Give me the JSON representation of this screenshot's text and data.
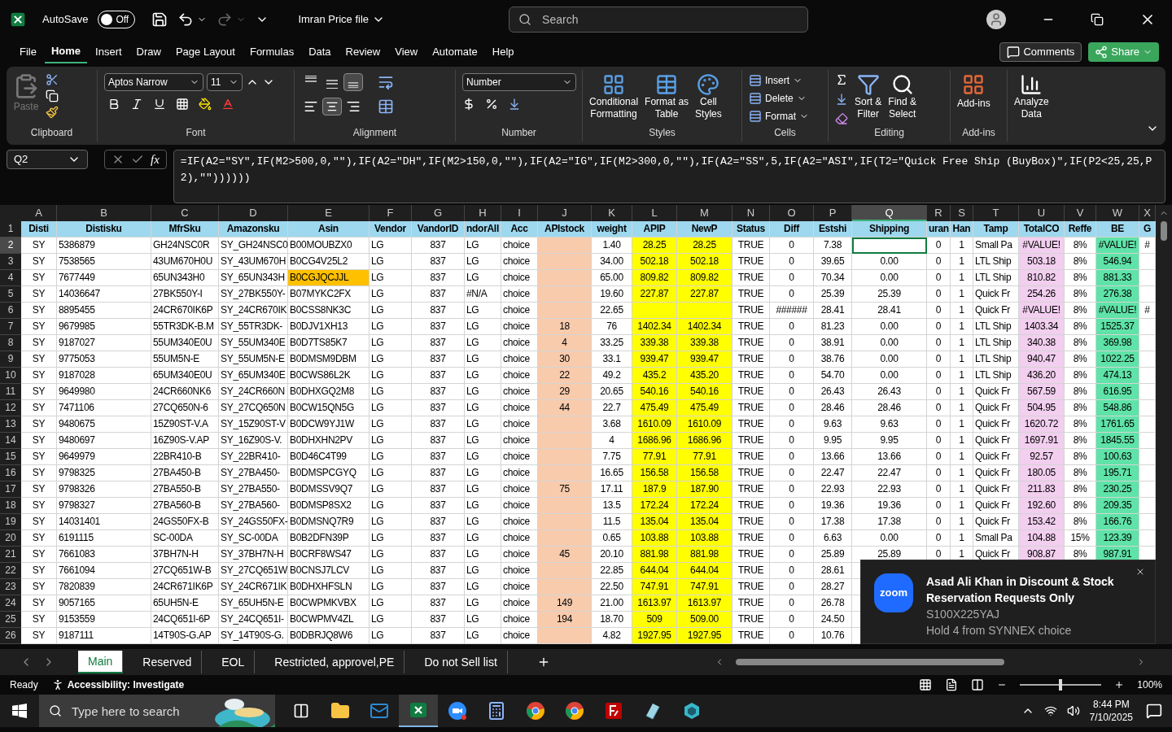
{
  "titlebar": {
    "autosave": "AutoSave",
    "autosave_toggle": {
      "label": "Off",
      "on": false
    },
    "file_name": "Imran Price file",
    "search": {
      "placeholder": "Search"
    }
  },
  "menu": {
    "tabs": [
      {
        "label": "File",
        "selected": false
      },
      {
        "label": "Home",
        "selected": true
      },
      {
        "label": "Insert",
        "selected": false
      },
      {
        "label": "Draw",
        "selected": false
      },
      {
        "label": "Page Layout",
        "selected": false
      },
      {
        "label": "Formulas",
        "selected": false
      },
      {
        "label": "Data",
        "selected": false
      },
      {
        "label": "Review",
        "selected": false
      },
      {
        "label": "View",
        "selected": false
      },
      {
        "label": "Automate",
        "selected": false
      },
      {
        "label": "Help",
        "selected": false
      }
    ],
    "comments": "Comments",
    "share": "Share"
  },
  "ribbon": {
    "clipboard": {
      "label": "Clipboard",
      "paste": "Paste",
      "paste_disabled": true
    },
    "font": {
      "label": "Font",
      "family": "Aptos Narrow",
      "size": "11"
    },
    "alignment": {
      "label": "Alignment",
      "vertical": [
        {
          "kind": "top",
          "selected": false
        },
        {
          "kind": "middle",
          "selected": false
        },
        {
          "kind": "bottom",
          "selected": true
        }
      ],
      "horizontal": [
        {
          "kind": "left",
          "selected": false
        },
        {
          "kind": "center",
          "selected": true
        },
        {
          "kind": "right",
          "selected": false
        }
      ]
    },
    "number": {
      "label": "Number",
      "format": "Number"
    },
    "styles": {
      "label": "Styles",
      "buttons": [
        [
          "Conditional",
          "Formatting"
        ],
        [
          "Format as",
          "Table"
        ],
        [
          "Cell",
          "Styles"
        ]
      ]
    },
    "cells": {
      "label": "Cells",
      "buttons": [
        "Insert",
        "Delete",
        "Format"
      ]
    },
    "editing": {
      "label": "Editing",
      "buttons": [
        [
          "Sort &",
          "Filter"
        ],
        [
          "Find &",
          "Select"
        ]
      ]
    },
    "addins": {
      "label": "Add-ins",
      "button": "Add-ins"
    },
    "analyze": [
      "Analyze",
      "Data"
    ]
  },
  "formula_bar": {
    "name_box": "Q2",
    "function_label": "fx",
    "formula": "=IF(A2=\"SY\",IF(M2>500,0,\"\"),IF(A2=\"DH\",IF(M2>150,0,\"\"),IF(A2=\"IG\",IF(M2>300,0,\"\"),IF(A2=\"SS\",5,IF(A2=\"ASI\",IF(T2=\"Quick Free Ship (BuyBox)\",IF(P2<25,25,P2),\"\"))))))"
  },
  "sheet": {
    "columns": [
      {
        "letter": "A",
        "selected": false
      },
      {
        "letter": "B",
        "selected": false
      },
      {
        "letter": "C",
        "selected": false
      },
      {
        "letter": "D",
        "selected": false
      },
      {
        "letter": "E",
        "selected": false
      },
      {
        "letter": "F",
        "selected": false
      },
      {
        "letter": "G",
        "selected": false
      },
      {
        "letter": "H",
        "selected": false
      },
      {
        "letter": "I",
        "selected": false
      },
      {
        "letter": "J",
        "selected": false,
        "color": "#f8cbad"
      },
      {
        "letter": "K",
        "selected": false
      },
      {
        "letter": "L",
        "selected": false,
        "color": "#ffff00"
      },
      {
        "letter": "M",
        "selected": false,
        "color": "#ffff00"
      },
      {
        "letter": "N",
        "selected": false
      },
      {
        "letter": "O",
        "selected": false
      },
      {
        "letter": "P",
        "selected": false
      },
      {
        "letter": "Q",
        "selected": true
      },
      {
        "letter": "R",
        "selected": false
      },
      {
        "letter": "S",
        "selected": false
      },
      {
        "letter": "T",
        "selected": false
      },
      {
        "letter": "U",
        "selected": false,
        "color": "#f2ceef"
      },
      {
        "letter": "V",
        "selected": false
      },
      {
        "letter": "W",
        "selected": false,
        "color": "#5fe3a8"
      },
      {
        "letter": "X",
        "selected": false
      }
    ],
    "rows": [
      {
        "number": "1",
        "kind": "header",
        "selected": false,
        "cells": [
          "Disti",
          "Distisku",
          "MfrSku",
          "Amazonsku",
          "Asin",
          "Vendor",
          "VandorID",
          "ndorAll",
          "Acc",
          "APIstock",
          "weight",
          "APIP",
          "NewP",
          "Status",
          "Diff",
          "Estshi",
          "Shipping",
          "uran",
          "Han",
          "Tamp",
          "TotalCO",
          "Reffe",
          "BE",
          "G"
        ]
      },
      {
        "number": "2",
        "kind": "data",
        "selected": true,
        "cells": [
          "SY",
          "5386879",
          "GH24NSC0R",
          "SY_GH24NSC0",
          "B00MOUBZX0",
          "LG",
          "837",
          "LG",
          "choice",
          null,
          "1.40",
          "28.25",
          "28.25",
          "TRUE",
          "0",
          "7.38",
          null,
          "0",
          "1",
          "Small Pa",
          "#VALUE!",
          "8%",
          "#VALUE!",
          "#"
        ]
      },
      {
        "number": "3",
        "kind": "data",
        "selected": false,
        "cells": [
          "SY",
          "7538565",
          "43UM670H0U",
          "SY_43UM670H",
          "B0CG4V25L2",
          "LG",
          "837",
          "LG",
          "choice",
          null,
          "34.00",
          "502.18",
          "502.18",
          "TRUE",
          "0",
          "39.65",
          "0.00",
          "0",
          "1",
          "LTL Ship",
          "503.18",
          "8%",
          "546.94"
        ]
      },
      {
        "number": "4",
        "kind": "data",
        "selected": false,
        "cells": [
          "SY",
          "7677449",
          "65UN343H0",
          "SY_65UN343H",
          {
            "text": "B0CGJQCJJL",
            "color": "#ffc000"
          },
          "LG",
          "837",
          "LG",
          "choice",
          null,
          "65.00",
          "809.82",
          "809.82",
          "TRUE",
          "0",
          "70.34",
          "0.00",
          "0",
          "1",
          "LTL Ship",
          "810.82",
          "8%",
          "881.33"
        ]
      },
      {
        "number": "5",
        "kind": "data",
        "selected": false,
        "cells": [
          "SY",
          "14036647",
          "27BK550Y-I",
          "SY_27BK550Y-",
          "B07MYKC2FX",
          "LG",
          "837",
          "#N/A",
          "choice",
          null,
          "19.60",
          "227.87",
          "227.87",
          "TRUE",
          "0",
          "25.39",
          "25.39",
          "0",
          "1",
          "Quick Fr",
          "254.26",
          "8%",
          "276.38"
        ]
      },
      {
        "number": "6",
        "kind": "data",
        "selected": false,
        "cells": [
          "SY",
          "8895455",
          "24CR670IK6P",
          "SY_24CR670IK",
          "B0CSS8NK3C",
          "LG",
          "837",
          "LG",
          "choice",
          null,
          "22.65",
          null,
          null,
          "TRUE",
          "######",
          "28.41",
          "28.41",
          "0",
          "1",
          "Quick Fr",
          "#VALUE!",
          "8%",
          "#VALUE!",
          "#"
        ]
      },
      {
        "number": "7",
        "kind": "data",
        "selected": false,
        "cells": [
          "SY",
          "9679985",
          "55TR3DK-B.M",
          "SY_55TR3DK-",
          "B0DJV1XH13",
          "LG",
          "837",
          "LG",
          "choice",
          "18",
          "76",
          "1402.34",
          "1402.34",
          "TRUE",
          "0",
          "81.23",
          "0.00",
          "0",
          "1",
          "LTL Ship",
          "1403.34",
          "8%",
          "1525.37"
        ]
      },
      {
        "number": "8",
        "kind": "data",
        "selected": false,
        "cells": [
          "SY",
          "9187027",
          "55UM340E0U",
          "SY_55UM340E",
          "B0D7TS85K7",
          "LG",
          "837",
          "LG",
          "choice",
          "4",
          "33.25",
          "339.38",
          "339.38",
          "TRUE",
          "0",
          "38.91",
          "0.00",
          "0",
          "1",
          "LTL Ship",
          "340.38",
          "8%",
          "369.98"
        ]
      },
      {
        "number": "9",
        "kind": "data",
        "selected": false,
        "cells": [
          "SY",
          "9775053",
          "55UM5N-E",
          "SY_55UM5N-E",
          "B0DMSM9DBM",
          "LG",
          "837",
          "LG",
          "choice",
          "30",
          "33.1",
          "939.47",
          "939.47",
          "TRUE",
          "0",
          "38.76",
          "0.00",
          "0",
          "1",
          "LTL Ship",
          "940.47",
          "8%",
          "1022.25"
        ]
      },
      {
        "number": "10",
        "kind": "data",
        "selected": false,
        "cells": [
          "SY",
          "9187028",
          "65UM340E0U",
          "SY_65UM340E",
          "B0CWS86L2K",
          "LG",
          "837",
          "LG",
          "choice",
          "22",
          "49.2",
          "435.2",
          "435.20",
          "TRUE",
          "0",
          "54.70",
          "0.00",
          "0",
          "1",
          "LTL Ship",
          "436.20",
          "8%",
          "474.13"
        ]
      },
      {
        "number": "11",
        "kind": "data",
        "selected": false,
        "cells": [
          "SY",
          "9649980",
          "24CR660NK6",
          "SY_24CR660N",
          "B0DHXGQ2M8",
          "LG",
          "837",
          "LG",
          "choice",
          "29",
          "20.65",
          "540.16",
          "540.16",
          "TRUE",
          "0",
          "26.43",
          "26.43",
          "0",
          "1",
          "Quick Fr",
          "567.59",
          "8%",
          "616.95"
        ]
      },
      {
        "number": "12",
        "kind": "data",
        "selected": false,
        "cells": [
          "SY",
          "7471106",
          "27CQ650N-6",
          "SY_27CQ650N",
          "B0CW15QN5G",
          "LG",
          "837",
          "LG",
          "choice",
          "44",
          "22.7",
          "475.49",
          "475.49",
          "TRUE",
          "0",
          "28.46",
          "28.46",
          "0",
          "1",
          "Quick Fr",
          "504.95",
          "8%",
          "548.86"
        ]
      },
      {
        "number": "13",
        "kind": "data",
        "selected": false,
        "cells": [
          "SY",
          "9480675",
          "15Z90ST-V.A",
          "SY_15Z90ST-V",
          "B0DCW9YJ1W",
          "LG",
          "837",
          "LG",
          "choice",
          null,
          "3.68",
          "1610.09",
          "1610.09",
          "TRUE",
          "0",
          "9.63",
          "9.63",
          "0",
          "1",
          "Quick Fr",
          "1620.72",
          "8%",
          "1761.65"
        ]
      },
      {
        "number": "14",
        "kind": "data",
        "selected": false,
        "cells": [
          "SY",
          "9480697",
          "16Z90S-V.AP",
          "SY_16Z90S-V.",
          "B0DHXHN2PV",
          "LG",
          "837",
          "LG",
          "choice",
          null,
          "4",
          "1686.96",
          "1686.96",
          "TRUE",
          "0",
          "9.95",
          "9.95",
          "0",
          "1",
          "Quick Fr",
          "1697.91",
          "8%",
          "1845.55"
        ]
      },
      {
        "number": "15",
        "kind": "data",
        "selected": false,
        "cells": [
          "SY",
          "9649979",
          "22BR410-B",
          "SY_22BR410-",
          "B0D46C4T99",
          "LG",
          "837",
          "LG",
          "choice",
          null,
          "7.75",
          "77.91",
          "77.91",
          "TRUE",
          "0",
          "13.66",
          "13.66",
          "0",
          "1",
          "Quick Fr",
          "92.57",
          "8%",
          "100.63"
        ]
      },
      {
        "number": "16",
        "kind": "data",
        "selected": false,
        "cells": [
          "SY",
          "9798325",
          "27BA450-B",
          "SY_27BA450-",
          "B0DMSPCGYQ",
          "LG",
          "837",
          "LG",
          "choice",
          null,
          "16.65",
          "156.58",
          "156.58",
          "TRUE",
          "0",
          "22.47",
          "22.47",
          "0",
          "1",
          "Quick Fr",
          "180.05",
          "8%",
          "195.71"
        ]
      },
      {
        "number": "17",
        "kind": "data",
        "selected": false,
        "cells": [
          "SY",
          "9798326",
          "27BA550-B",
          "SY_27BA550-",
          "B0DMSSV9Q7",
          "LG",
          "837",
          "LG",
          "choice",
          "75",
          "17.11",
          "187.9",
          "187.90",
          "TRUE",
          "0",
          "22.93",
          "22.93",
          "0",
          "1",
          "Quick Fr",
          "211.83",
          "8%",
          "230.25"
        ]
      },
      {
        "number": "18",
        "kind": "data",
        "selected": false,
        "cells": [
          "SY",
          "9798327",
          "27BA560-B",
          "SY_27BA560-",
          "B0DMSP8SX2",
          "LG",
          "837",
          "LG",
          "choice",
          null,
          "13.5",
          "172.24",
          "172.24",
          "TRUE",
          "0",
          "19.36",
          "19.36",
          "0",
          "1",
          "Quick Fr",
          "192.60",
          "8%",
          "209.35"
        ]
      },
      {
        "number": "19",
        "kind": "data",
        "selected": false,
        "cells": [
          "SY",
          "14031401",
          "24GS50FX-B",
          "SY_24GS50FX-",
          "B0DMSNQ7R9",
          "LG",
          "837",
          "LG",
          "choice",
          null,
          "11.5",
          "135.04",
          "135.04",
          "TRUE",
          "0",
          "17.38",
          "17.38",
          "0",
          "1",
          "Quick Fr",
          "153.42",
          "8%",
          "166.76"
        ]
      },
      {
        "number": "20",
        "kind": "data",
        "selected": false,
        "cells": [
          "SY",
          "6191115",
          "SC-00DA",
          "SY_SC-00DA",
          "B0B2DFN39P",
          "LG",
          "837",
          "LG",
          "choice",
          null,
          "0.65",
          "103.88",
          "103.88",
          "TRUE",
          "0",
          "6.63",
          "0.00",
          "0",
          "1",
          "Small Pa",
          "104.88",
          "15%",
          "123.39"
        ]
      },
      {
        "number": "21",
        "kind": "data",
        "selected": false,
        "cells": [
          "SY",
          "7661083",
          "37BH7N-H",
          "SY_37BH7N-H",
          "B0CRF8WS47",
          "LG",
          "837",
          "LG",
          "choice",
          "45",
          "20.10",
          "881.98",
          "881.98",
          "TRUE",
          "0",
          "25.89",
          "25.89",
          "0",
          "1",
          "Quick Fr",
          "908.87",
          "8%",
          "987.91"
        ]
      },
      {
        "number": "22",
        "kind": "data",
        "selected": false,
        "cells": [
          "SY",
          "7661094",
          "27CQ651W-B",
          "SY_27CQ651W",
          "B0CNSJ7LCV",
          "LG",
          "837",
          "LG",
          "choice",
          null,
          "22.85",
          "644.04",
          "644.04",
          "TRUE",
          "0",
          "28.61"
        ]
      },
      {
        "number": "23",
        "kind": "data",
        "selected": false,
        "cells": [
          "SY",
          "7820839",
          "24CR671IK6P",
          "SY_24CR671IK",
          "B0DHXHFSLN",
          "LG",
          "837",
          "LG",
          "choice",
          null,
          "22.50",
          "747.91",
          "747.91",
          "TRUE",
          "0",
          "28.27"
        ]
      },
      {
        "number": "24",
        "kind": "data",
        "selected": false,
        "cells": [
          "SY",
          "9057165",
          "65UH5N-E",
          "SY_65UH5N-E",
          "B0CWPMKVBX",
          "LG",
          "837",
          "LG",
          "choice",
          "149",
          "21.00",
          "1613.97",
          "1613.97",
          "TRUE",
          "0",
          "26.78"
        ]
      },
      {
        "number": "25",
        "kind": "data",
        "selected": false,
        "cells": [
          "SY",
          "9153559",
          "24CQ651I-6P",
          "SY_24CQ651I-",
          "B0CWPMV4ZL",
          "LG",
          "837",
          "LG",
          "choice",
          "194",
          "18.70",
          "509",
          "509.00",
          "TRUE",
          "0",
          "24.50"
        ]
      },
      {
        "number": "26",
        "kind": "data",
        "selected": false,
        "cells": [
          "SY",
          "9187111",
          "14T90S-G.AP",
          "SY_14T90S-G.",
          "B0DBRJQ8W6",
          "LG",
          "837",
          "LG",
          "choice",
          null,
          "4.82",
          "1927.95",
          "1927.95",
          "TRUE",
          "0",
          "10.76"
        ]
      }
    ]
  },
  "notification": {
    "app_logo": "zoom",
    "title": "Asad Ali Khan in Discount & Stock Reservation Requests Only",
    "lines": [
      "S100X225YAJ",
      "Hold 4 from SYNNEX choice"
    ]
  },
  "sheet_tabs": [
    {
      "label": "Main",
      "selected": true
    },
    {
      "label": "Reserved",
      "selected": false
    },
    {
      "label": "EOL",
      "selected": false
    },
    {
      "label": "Restricted, approvel,PE",
      "selected": false
    },
    {
      "label": "Do not Sell list",
      "selected": false
    }
  ],
  "status_bar": {
    "mode": "Ready",
    "accessibility": "Accessibility: Investigate",
    "zoom": "100%",
    "zoom_level": {
      "level": 0.5
    }
  },
  "taskbar": {
    "search": {
      "placeholder": "Type here to search"
    },
    "apps": [
      {
        "kind": "taskview",
        "selected": false
      },
      {
        "kind": "folder",
        "selected": false
      },
      {
        "kind": "mail",
        "selected": false
      },
      {
        "kind": "excel",
        "selected": true
      },
      {
        "kind": "zoom",
        "selected": false
      },
      {
        "kind": "calculator",
        "selected": false
      },
      {
        "kind": "browser",
        "selected": false
      },
      {
        "kind": "browser",
        "selected": false
      },
      {
        "kind": "ftp",
        "selected": false
      },
      {
        "kind": "notes",
        "selected": false
      },
      {
        "kind": "cube",
        "selected": false
      }
    ],
    "time": "8:44 PM",
    "date": "7/10/2025"
  }
}
